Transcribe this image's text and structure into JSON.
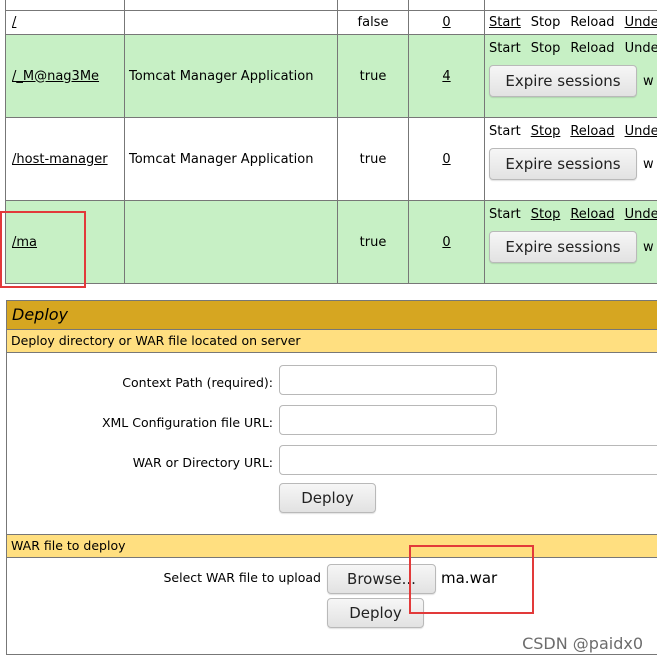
{
  "applications": {
    "rows": [
      {
        "path": "/",
        "display_name": "",
        "running": "false",
        "sessions": "0",
        "commands": [
          "Start",
          "Stop",
          "Reload",
          "Undep"
        ],
        "has_expire": false,
        "bg": "white"
      },
      {
        "path": "/_M@nag3Me",
        "display_name": "Tomcat Manager Application",
        "running": "true",
        "sessions": "4",
        "commands": [
          "Start",
          "Stop",
          "Reload",
          "Undep"
        ],
        "expire_label": "Expire sessions",
        "idle_label": "w",
        "has_expire": true,
        "bg": "green"
      },
      {
        "path": "/host-manager",
        "display_name": "Tomcat Manager Application",
        "running": "true",
        "sessions": "0",
        "commands": [
          "Start",
          "Stop",
          "Reload",
          "Undep"
        ],
        "expire_label": "Expire sessions",
        "idle_label": "w",
        "has_expire": true,
        "bg": "white"
      },
      {
        "path": "/ma",
        "display_name": "",
        "running": "true",
        "sessions": "0",
        "commands": [
          "Start",
          "Stop",
          "Reload",
          "Undep"
        ],
        "expire_label": "Expire sessions",
        "idle_label": "w",
        "has_expire": true,
        "bg": "green"
      }
    ]
  },
  "deploy": {
    "title": "Deploy",
    "server_section_title": "Deploy directory or WAR file located on server",
    "context_path_label": "Context Path (required):",
    "context_path_value": "",
    "xml_config_label": "XML Configuration file URL:",
    "xml_config_value": "",
    "war_dir_label": "WAR or Directory URL:",
    "war_dir_value": "",
    "deploy_button": "Deploy",
    "war_section_title": "WAR file to deploy",
    "select_war_label": "Select WAR file to upload",
    "browse_button": "Browse...",
    "selected_file": "ma.war",
    "upload_deploy_button": "Deploy"
  },
  "watermark": "CSDN @paidx0",
  "colors": {
    "row_green": "#c7f0c5",
    "deploy_header": "#d6a621",
    "section_header": "#ffdf80",
    "highlight_red": "#e23a3a"
  }
}
